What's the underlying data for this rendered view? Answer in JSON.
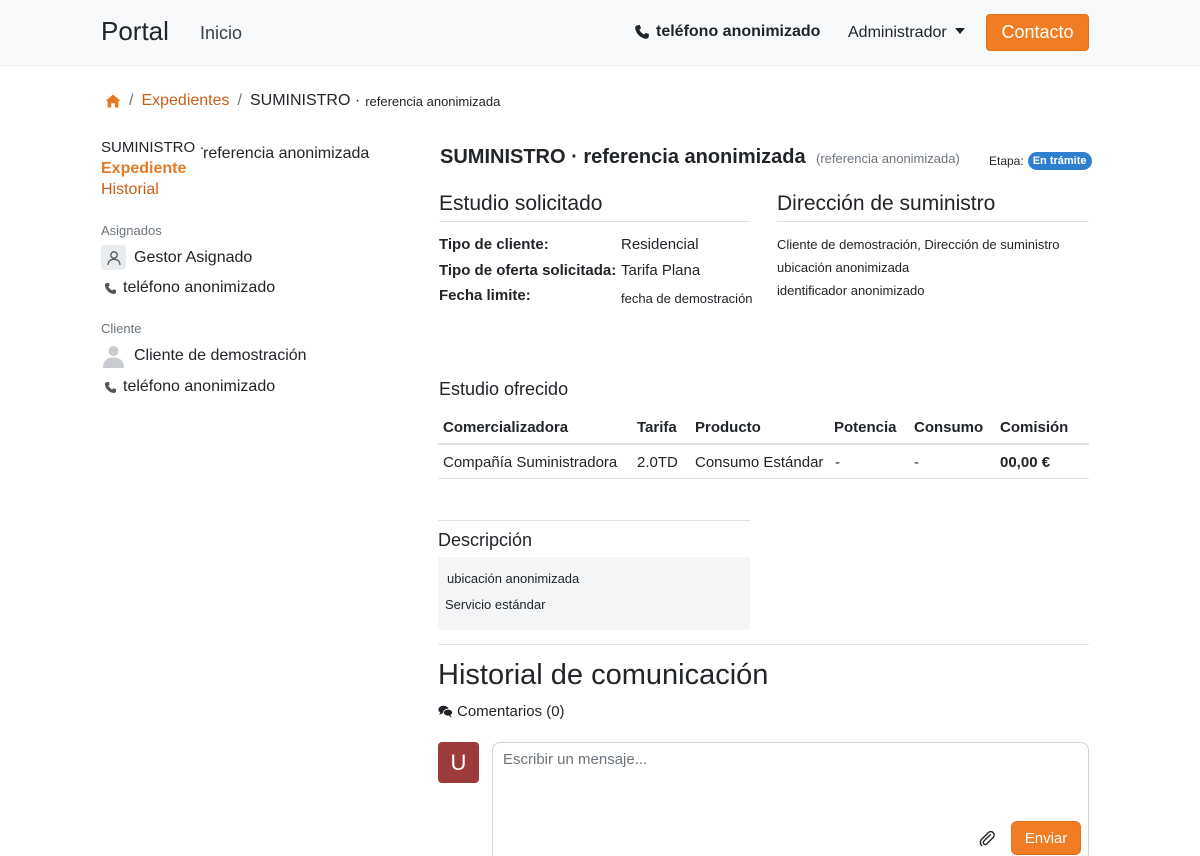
{
  "navbar": {
    "brand": "Portal",
    "home": "Inicio",
    "phone": "teléfono anonimizado",
    "admin": "Administrador",
    "contact": "Contacto"
  },
  "breadcrumb": {
    "link": "Expedientes",
    "current_a": "SUMINISTRO ·",
    "current_b": "referencia anonimizada"
  },
  "sidebar": {
    "title_a": "SUMINISTRO ·",
    "title_b": "referencia anonimizada",
    "nav_active": "Expediente",
    "nav_item": "Historial",
    "assigned_label": "Asignados",
    "assigned_name": "Gestor Asignado",
    "assigned_phone": "teléfono anonimizado",
    "client_label": "Cliente",
    "client_name": "Cliente de demostración",
    "client_phone": "teléfono anonimizado"
  },
  "main": {
    "title": "SUMINISTRO · referencia anonimizada",
    "subtitle": "(referencia anonimizada)",
    "stage_label": "Etapa:",
    "stage_badge": "En trámite",
    "requested_heading": "Estudio solicitado",
    "requested": {
      "client_type_key": "Tipo de cliente:",
      "client_type_val": "Residencial",
      "offer_key": "Tipo de oferta solicitada:",
      "offer_val": "Tarifa Plana",
      "deadline_key": "Fecha limite:",
      "deadline_val": "fecha de demostración"
    },
    "address_heading": "Dirección de suministro",
    "address": {
      "line1": "Cliente de demostración, Dirección de suministro",
      "line2": "ubicación anonimizada",
      "line3": "identificador anonimizado"
    },
    "offered_heading": "Estudio ofrecido",
    "table": {
      "headers": [
        "Comercializadora",
        "Tarifa",
        "Producto",
        "Potencia",
        "Consumo",
        "Comisión"
      ],
      "rows": [
        [
          "Compañía Suministradora",
          "2.0TD",
          "Consumo Estándar",
          "-",
          "-",
          "00,00 €"
        ]
      ]
    },
    "description_heading": "Descripción",
    "description": {
      "line1": "ubicación anonimizada",
      "line2": "Servicio estándar"
    },
    "history_heading": "Historial de comunicación",
    "comments": "Comentarios (0)",
    "user_initial": "U",
    "message_placeholder": "Escribir un mensaje...",
    "send": "Enviar"
  },
  "colors": {
    "accent": "#f07d23",
    "link": "#c8601a",
    "badge": "#2f7fd1",
    "avatar": "#9d3b3b"
  }
}
